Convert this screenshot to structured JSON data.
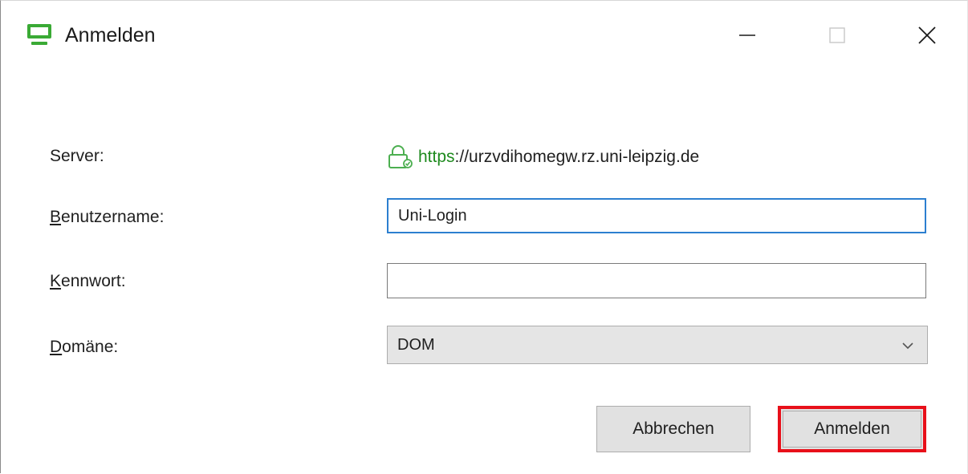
{
  "window": {
    "title": "Anmelden",
    "accent_color": "#3aaa35",
    "highlight_color": "#e8101a",
    "icons": {
      "app": "vmware-horizon-monitor-icon",
      "minimize": "minimize-icon",
      "maximize": "maximize-icon",
      "close": "close-icon"
    }
  },
  "form": {
    "server_label": "Server:",
    "server_scheme": "https",
    "server_rest": "://urzvdihomegw.rz.uni-leipzig.de",
    "server_icon": "secure-lock-icon",
    "username_label": "Benutzername:",
    "username_value": "Uni-Login",
    "password_label": "Kennwort:",
    "password_value": "",
    "domain_label": "Domäne:",
    "domain_selected": "DOM"
  },
  "buttons": {
    "cancel_label": "Abbrechen",
    "login_label": "Anmelden"
  }
}
